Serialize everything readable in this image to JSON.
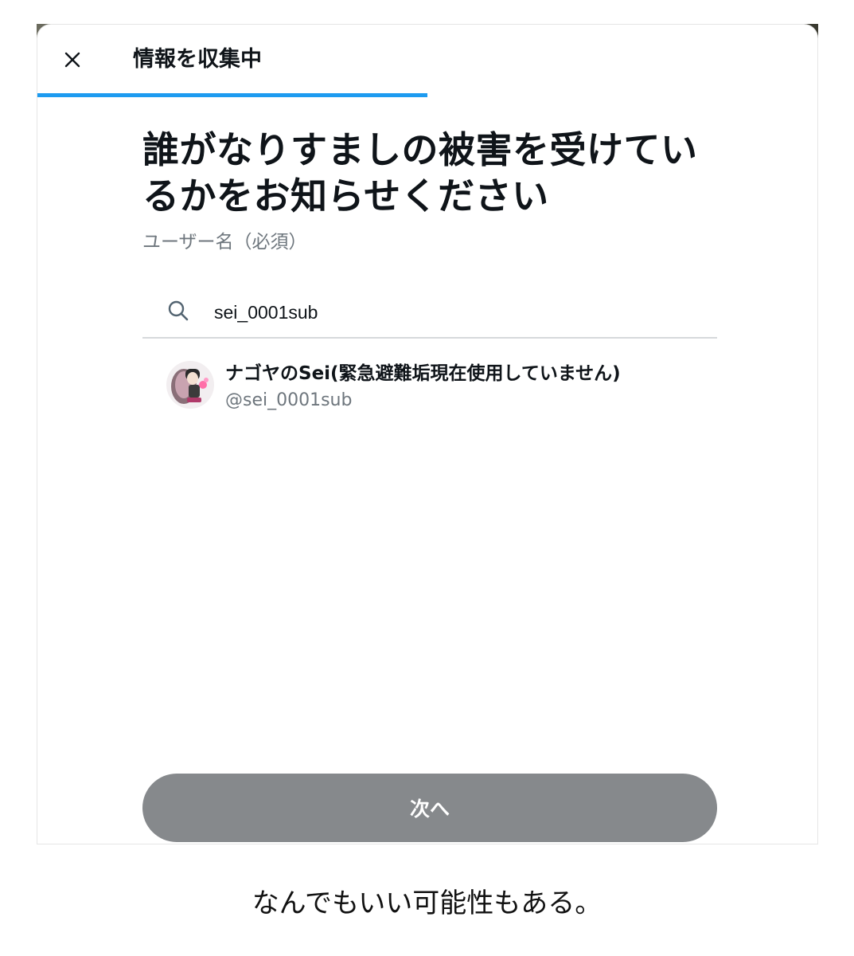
{
  "dialog": {
    "title": "情報を収集中",
    "progress": 0.5
  },
  "main": {
    "heading": "誰がなりすましの被害を受けているかをお知らせください",
    "field_label": "ユーザー名（必須）"
  },
  "search": {
    "value": "sei_0001sub"
  },
  "result": {
    "name": "ナゴヤのSei(緊急避難垢現在使用していません)",
    "handle": "@sei_0001sub"
  },
  "next_button": {
    "label": "次へ"
  },
  "caption": "なんでもいい可能性もある。",
  "colors": {
    "accent": "#1d9bf0",
    "button_disabled": "#86898c",
    "text_primary": "#0f1419",
    "text_secondary": "#6e767d"
  },
  "icons": {
    "close": "close-icon",
    "search": "search-icon"
  }
}
